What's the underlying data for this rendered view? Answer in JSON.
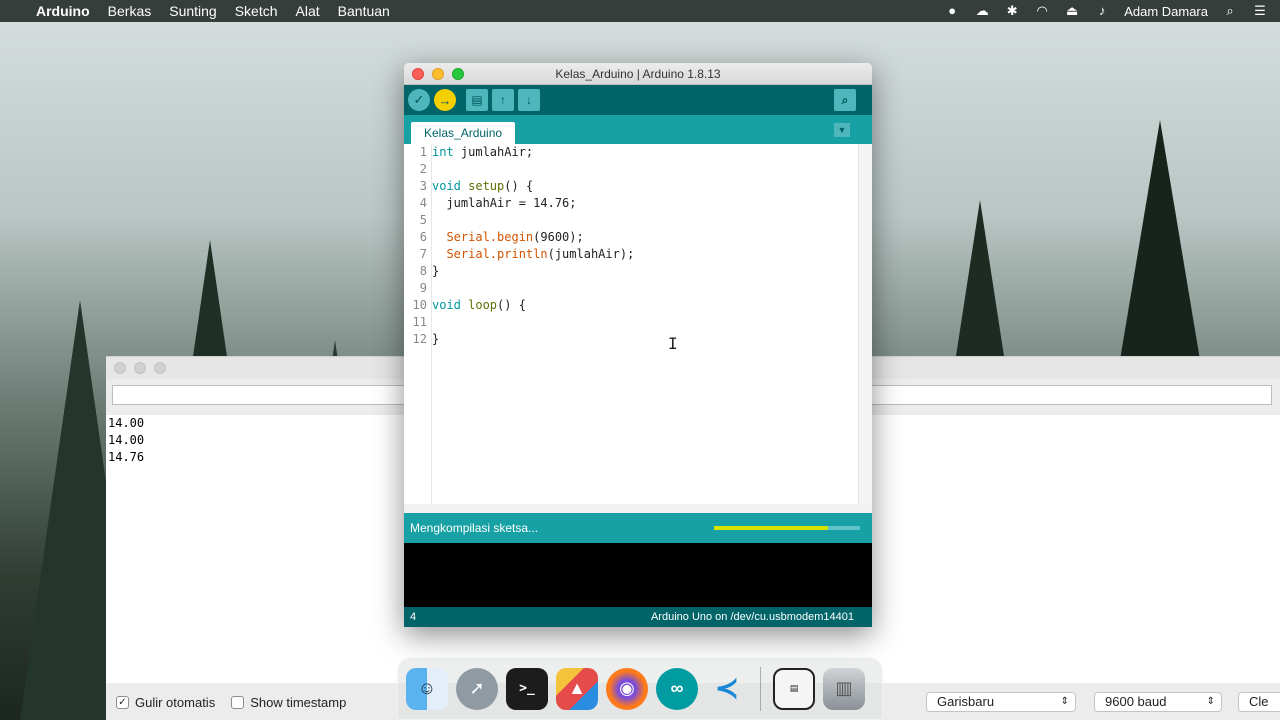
{
  "menubar": {
    "app": "Arduino",
    "items": [
      "Berkas",
      "Sunting",
      "Sketch",
      "Alat",
      "Bantuan"
    ],
    "user": "Adam Damara"
  },
  "ide": {
    "title": "Kelas_Arduino | Arduino 1.8.13",
    "tab": "Kelas_Arduino",
    "line_numbers": [
      "1",
      "2",
      "3",
      "4",
      "5",
      "6",
      "7",
      "8",
      "9",
      "10",
      "11",
      "12"
    ],
    "code": {
      "l1_type": "int",
      "l1_rest": " jumlahAir;",
      "l3_type": "void",
      "l3_fn": " setup",
      "l3_rest": "() {",
      "l4": "  jumlahAir = 14.76;",
      "l6_obj": "  Serial",
      "l6_fn": ".begin",
      "l6_rest": "(9600);",
      "l7_obj": "  Serial",
      "l7_fn": ".println",
      "l7_rest": "(jumlahAir);",
      "l8": "}",
      "l10_type": "void",
      "l10_fn": " loop",
      "l10_rest": "() {",
      "l12": "}"
    },
    "status_text": "Mengkompilasi sketsa...",
    "progress": 0.78,
    "footer_line": "4",
    "footer_board": "Arduino Uno on /dev/cu.usbmodem14401"
  },
  "serial": {
    "output": [
      "14.00",
      "14.00",
      "14.76"
    ],
    "autoscroll_label": "Gulir otomatis",
    "autoscroll_checked": "✓",
    "timestamp_label": "Show timestamp",
    "line_ending": "Garisbaru",
    "baud": "9600 baud",
    "clear_label": "Cle"
  },
  "colors": {
    "arduino_dark": "#006468",
    "arduino_teal": "#17a1a5",
    "arduino_light": "#4db7bb",
    "progress_fill": "#d7e300"
  }
}
